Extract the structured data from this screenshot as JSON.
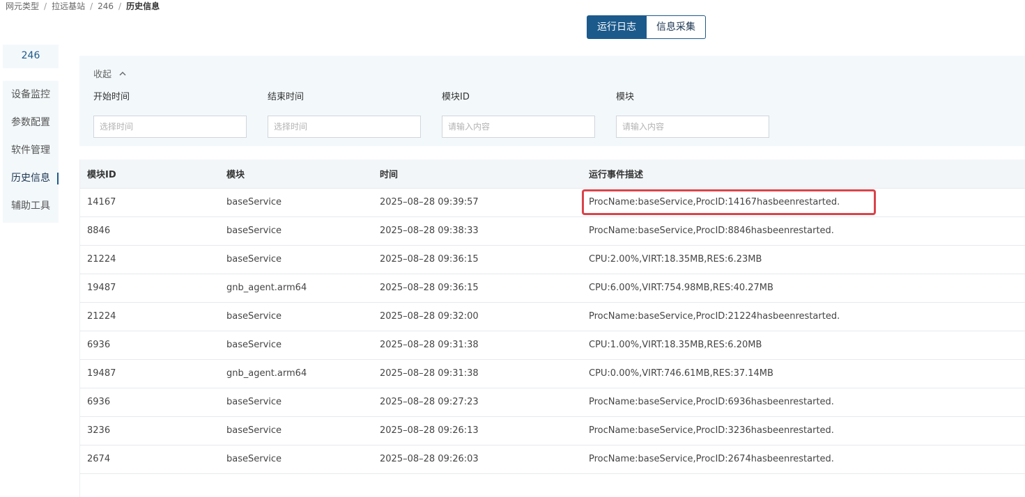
{
  "breadcrumb": [
    "网元类型",
    "拉远基站",
    "246",
    "历史信息"
  ],
  "breadcrumb_separator": "/",
  "tabs": [
    {
      "label": "运行日志",
      "active": true
    },
    {
      "label": "信息采集",
      "active": false
    }
  ],
  "sidebar": {
    "device_id": "246",
    "items": [
      {
        "label": "设备监控",
        "active": false
      },
      {
        "label": "参数配置",
        "active": false
      },
      {
        "label": "软件管理",
        "active": false
      },
      {
        "label": "历史信息",
        "active": true
      },
      {
        "label": "辅助工具",
        "active": false
      }
    ]
  },
  "filters": {
    "collapse_label": "收起",
    "fields": [
      {
        "label": "开始时间",
        "placeholder": "选择时间",
        "value": ""
      },
      {
        "label": "结束时间",
        "placeholder": "选择时间",
        "value": ""
      },
      {
        "label": "模块ID",
        "placeholder": "请输入内容",
        "value": ""
      },
      {
        "label": "模块",
        "placeholder": "请输入内容",
        "value": ""
      }
    ]
  },
  "table": {
    "columns": [
      "模块ID",
      "模块",
      "时间",
      "运行事件描述"
    ],
    "rows": [
      [
        "14167",
        "baseService",
        "2025–08–28 09:39:57",
        "ProcName:baseService,ProcID:14167hasbeenrestarted."
      ],
      [
        "8846",
        "baseService",
        "2025–08–28 09:38:33",
        "ProcName:baseService,ProcID:8846hasbeenrestarted."
      ],
      [
        "21224",
        "baseService",
        "2025–08–28 09:36:15",
        "CPU:2.00%,VIRT:18.35MB,RES:6.23MB"
      ],
      [
        "19487",
        "gnb_agent.arm64",
        "2025–08–28 09:36:15",
        "CPU:6.00%,VIRT:754.98MB,RES:40.27MB"
      ],
      [
        "21224",
        "baseService",
        "2025–08–28 09:32:00",
        "ProcName:baseService,ProcID:21224hasbeenrestarted."
      ],
      [
        "6936",
        "baseService",
        "2025–08–28 09:31:38",
        "CPU:1.00%,VIRT:18.35MB,RES:6.20MB"
      ],
      [
        "19487",
        "gnb_agent.arm64",
        "2025–08–28 09:31:38",
        "CPU:0.00%,VIRT:746.61MB,RES:37.14MB"
      ],
      [
        "6936",
        "baseService",
        "2025–08–28 09:27:23",
        "ProcName:baseService,ProcID:6936hasbeenrestarted."
      ],
      [
        "3236",
        "baseService",
        "2025–08–28 09:26:13",
        "ProcName:baseService,ProcID:3236hasbeenrestarted."
      ],
      [
        "2674",
        "baseService",
        "2025–08–28 09:26:03",
        "ProcName:baseService,ProcID:2674hasbeenrestarted."
      ]
    ]
  },
  "colors": {
    "accent": "#1c5a8c",
    "panel_bg": "#f3f8fb",
    "highlight_border": "#d9434a"
  }
}
